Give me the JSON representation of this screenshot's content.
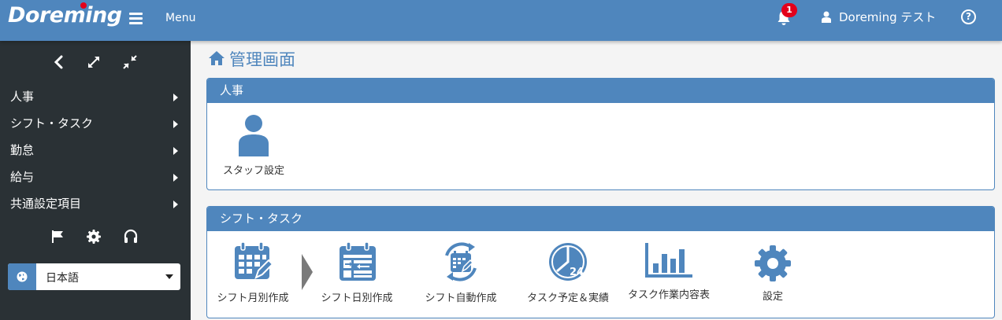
{
  "header": {
    "logo": "Doreming",
    "menu_label": "Menu",
    "notification_count": "1",
    "user_name": "Doreming テスト",
    "help_symbol": "?"
  },
  "sidebar": {
    "toolbar": [
      "chevron-left-icon",
      "expand-icon",
      "compress-icon"
    ],
    "items": [
      {
        "label": "人事"
      },
      {
        "label": "シフト・タスク"
      },
      {
        "label": "勤怠"
      },
      {
        "label": "給与"
      },
      {
        "label": "共通設定項目"
      }
    ],
    "bottom_icons": [
      "flag-icon",
      "gear-icon",
      "headset-icon"
    ],
    "language": {
      "selected": "日本語"
    }
  },
  "main": {
    "title": "管理画面",
    "sections": [
      {
        "title": "人事",
        "tiles": [
          {
            "label": "スタッフ設定",
            "icon": "user-icon"
          }
        ]
      },
      {
        "title": "シフト・タスク",
        "tiles": [
          {
            "label": "シフト月別作成",
            "icon": "calendar-edit-icon"
          },
          {
            "label": "シフト日別作成",
            "icon": "calendar-day-icon"
          },
          {
            "label": "シフト自動作成",
            "icon": "calendar-auto-icon"
          },
          {
            "label": "タスク予定＆実績",
            "icon": "clock-24-icon",
            "clock_text": "24"
          },
          {
            "label": "タスク作業内容表",
            "icon": "bar-chart-icon"
          },
          {
            "label": "設定",
            "icon": "gear-icon"
          }
        ]
      }
    ]
  },
  "colors": {
    "header": "#4f86bd",
    "sidebar": "#2a3135",
    "accent": "#4f86bd",
    "badge": "#e3001b"
  }
}
